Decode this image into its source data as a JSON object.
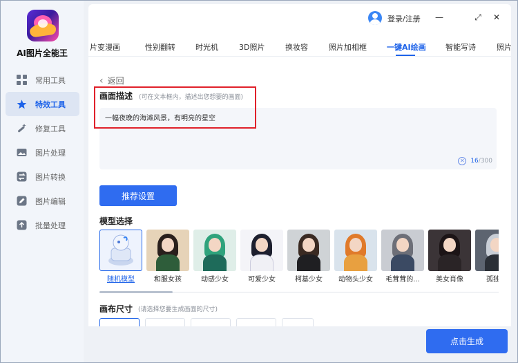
{
  "app": {
    "name": "AI图片全能王"
  },
  "sidebar": {
    "items": [
      {
        "label": "常用工具",
        "icon": "grid-icon",
        "active": false
      },
      {
        "label": "特效工具",
        "icon": "star-icon",
        "active": true
      },
      {
        "label": "修复工具",
        "icon": "magic-wand-icon",
        "active": false
      },
      {
        "label": "图片处理",
        "icon": "image-icon",
        "active": false
      },
      {
        "label": "图片转换",
        "icon": "convert-icon",
        "active": false
      },
      {
        "label": "图片编辑",
        "icon": "edit-icon",
        "active": false
      },
      {
        "label": "批量处理",
        "icon": "batch-icon",
        "active": false
      }
    ]
  },
  "header": {
    "login": "登录/注册",
    "window_controls": [
      "—",
      "⤢",
      "✕"
    ]
  },
  "tabs": [
    "片变漫画",
    "性别翻转",
    "时光机",
    "3D照片",
    "换妆容",
    "照片加相框",
    "一键AI绘画",
    "智能写诗",
    "照片"
  ],
  "active_tab": "一键AI绘画",
  "back_label": "返回",
  "description": {
    "title": "画面描述",
    "hint": "(可在文本框内，描述出您想要的画面)",
    "value": "一幅夜晚的海滩风景，有明亮的星空",
    "count": "16",
    "max": "/300"
  },
  "recommend_button": "推荐设置",
  "model_section": {
    "title": "模型选择",
    "models": [
      {
        "label": "随机模型",
        "selected": true
      },
      {
        "label": "和服女孩",
        "selected": false
      },
      {
        "label": "动感少女",
        "selected": false
      },
      {
        "label": "可爱少女",
        "selected": false
      },
      {
        "label": "柯基少女",
        "selected": false
      },
      {
        "label": "动物头少女",
        "selected": false
      },
      {
        "label": "毛茸茸的...",
        "selected": false
      },
      {
        "label": "美女肖像",
        "selected": false
      },
      {
        "label": "孤独少",
        "selected": false
      }
    ]
  },
  "canvas_section": {
    "title": "画布尺寸",
    "hint": "(请选择您要生成画面的尺寸)"
  },
  "generate_button": "点击生成",
  "colors": {
    "accent": "#2f6cf0",
    "highlight_box": "#e0202a"
  }
}
